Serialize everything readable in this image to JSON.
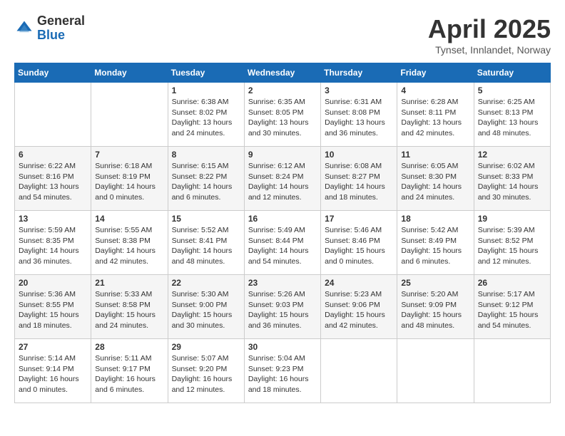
{
  "header": {
    "logo_general": "General",
    "logo_blue": "Blue",
    "title": "April 2025",
    "location": "Tynset, Innlandet, Norway"
  },
  "days_of_week": [
    "Sunday",
    "Monday",
    "Tuesday",
    "Wednesday",
    "Thursday",
    "Friday",
    "Saturday"
  ],
  "weeks": [
    [
      {
        "day": "",
        "sunrise": "",
        "sunset": "",
        "daylight": ""
      },
      {
        "day": "",
        "sunrise": "",
        "sunset": "",
        "daylight": ""
      },
      {
        "day": "1",
        "sunrise": "Sunrise: 6:38 AM",
        "sunset": "Sunset: 8:02 PM",
        "daylight": "Daylight: 13 hours and 24 minutes."
      },
      {
        "day": "2",
        "sunrise": "Sunrise: 6:35 AM",
        "sunset": "Sunset: 8:05 PM",
        "daylight": "Daylight: 13 hours and 30 minutes."
      },
      {
        "day": "3",
        "sunrise": "Sunrise: 6:31 AM",
        "sunset": "Sunset: 8:08 PM",
        "daylight": "Daylight: 13 hours and 36 minutes."
      },
      {
        "day": "4",
        "sunrise": "Sunrise: 6:28 AM",
        "sunset": "Sunset: 8:11 PM",
        "daylight": "Daylight: 13 hours and 42 minutes."
      },
      {
        "day": "5",
        "sunrise": "Sunrise: 6:25 AM",
        "sunset": "Sunset: 8:13 PM",
        "daylight": "Daylight: 13 hours and 48 minutes."
      }
    ],
    [
      {
        "day": "6",
        "sunrise": "Sunrise: 6:22 AM",
        "sunset": "Sunset: 8:16 PM",
        "daylight": "Daylight: 13 hours and 54 minutes."
      },
      {
        "day": "7",
        "sunrise": "Sunrise: 6:18 AM",
        "sunset": "Sunset: 8:19 PM",
        "daylight": "Daylight: 14 hours and 0 minutes."
      },
      {
        "day": "8",
        "sunrise": "Sunrise: 6:15 AM",
        "sunset": "Sunset: 8:22 PM",
        "daylight": "Daylight: 14 hours and 6 minutes."
      },
      {
        "day": "9",
        "sunrise": "Sunrise: 6:12 AM",
        "sunset": "Sunset: 8:24 PM",
        "daylight": "Daylight: 14 hours and 12 minutes."
      },
      {
        "day": "10",
        "sunrise": "Sunrise: 6:08 AM",
        "sunset": "Sunset: 8:27 PM",
        "daylight": "Daylight: 14 hours and 18 minutes."
      },
      {
        "day": "11",
        "sunrise": "Sunrise: 6:05 AM",
        "sunset": "Sunset: 8:30 PM",
        "daylight": "Daylight: 14 hours and 24 minutes."
      },
      {
        "day": "12",
        "sunrise": "Sunrise: 6:02 AM",
        "sunset": "Sunset: 8:33 PM",
        "daylight": "Daylight: 14 hours and 30 minutes."
      }
    ],
    [
      {
        "day": "13",
        "sunrise": "Sunrise: 5:59 AM",
        "sunset": "Sunset: 8:35 PM",
        "daylight": "Daylight: 14 hours and 36 minutes."
      },
      {
        "day": "14",
        "sunrise": "Sunrise: 5:55 AM",
        "sunset": "Sunset: 8:38 PM",
        "daylight": "Daylight: 14 hours and 42 minutes."
      },
      {
        "day": "15",
        "sunrise": "Sunrise: 5:52 AM",
        "sunset": "Sunset: 8:41 PM",
        "daylight": "Daylight: 14 hours and 48 minutes."
      },
      {
        "day": "16",
        "sunrise": "Sunrise: 5:49 AM",
        "sunset": "Sunset: 8:44 PM",
        "daylight": "Daylight: 14 hours and 54 minutes."
      },
      {
        "day": "17",
        "sunrise": "Sunrise: 5:46 AM",
        "sunset": "Sunset: 8:46 PM",
        "daylight": "Daylight: 15 hours and 0 minutes."
      },
      {
        "day": "18",
        "sunrise": "Sunrise: 5:42 AM",
        "sunset": "Sunset: 8:49 PM",
        "daylight": "Daylight: 15 hours and 6 minutes."
      },
      {
        "day": "19",
        "sunrise": "Sunrise: 5:39 AM",
        "sunset": "Sunset: 8:52 PM",
        "daylight": "Daylight: 15 hours and 12 minutes."
      }
    ],
    [
      {
        "day": "20",
        "sunrise": "Sunrise: 5:36 AM",
        "sunset": "Sunset: 8:55 PM",
        "daylight": "Daylight: 15 hours and 18 minutes."
      },
      {
        "day": "21",
        "sunrise": "Sunrise: 5:33 AM",
        "sunset": "Sunset: 8:58 PM",
        "daylight": "Daylight: 15 hours and 24 minutes."
      },
      {
        "day": "22",
        "sunrise": "Sunrise: 5:30 AM",
        "sunset": "Sunset: 9:00 PM",
        "daylight": "Daylight: 15 hours and 30 minutes."
      },
      {
        "day": "23",
        "sunrise": "Sunrise: 5:26 AM",
        "sunset": "Sunset: 9:03 PM",
        "daylight": "Daylight: 15 hours and 36 minutes."
      },
      {
        "day": "24",
        "sunrise": "Sunrise: 5:23 AM",
        "sunset": "Sunset: 9:06 PM",
        "daylight": "Daylight: 15 hours and 42 minutes."
      },
      {
        "day": "25",
        "sunrise": "Sunrise: 5:20 AM",
        "sunset": "Sunset: 9:09 PM",
        "daylight": "Daylight: 15 hours and 48 minutes."
      },
      {
        "day": "26",
        "sunrise": "Sunrise: 5:17 AM",
        "sunset": "Sunset: 9:12 PM",
        "daylight": "Daylight: 15 hours and 54 minutes."
      }
    ],
    [
      {
        "day": "27",
        "sunrise": "Sunrise: 5:14 AM",
        "sunset": "Sunset: 9:14 PM",
        "daylight": "Daylight: 16 hours and 0 minutes."
      },
      {
        "day": "28",
        "sunrise": "Sunrise: 5:11 AM",
        "sunset": "Sunset: 9:17 PM",
        "daylight": "Daylight: 16 hours and 6 minutes."
      },
      {
        "day": "29",
        "sunrise": "Sunrise: 5:07 AM",
        "sunset": "Sunset: 9:20 PM",
        "daylight": "Daylight: 16 hours and 12 minutes."
      },
      {
        "day": "30",
        "sunrise": "Sunrise: 5:04 AM",
        "sunset": "Sunset: 9:23 PM",
        "daylight": "Daylight: 16 hours and 18 minutes."
      },
      {
        "day": "",
        "sunrise": "",
        "sunset": "",
        "daylight": ""
      },
      {
        "day": "",
        "sunrise": "",
        "sunset": "",
        "daylight": ""
      },
      {
        "day": "",
        "sunrise": "",
        "sunset": "",
        "daylight": ""
      }
    ]
  ]
}
